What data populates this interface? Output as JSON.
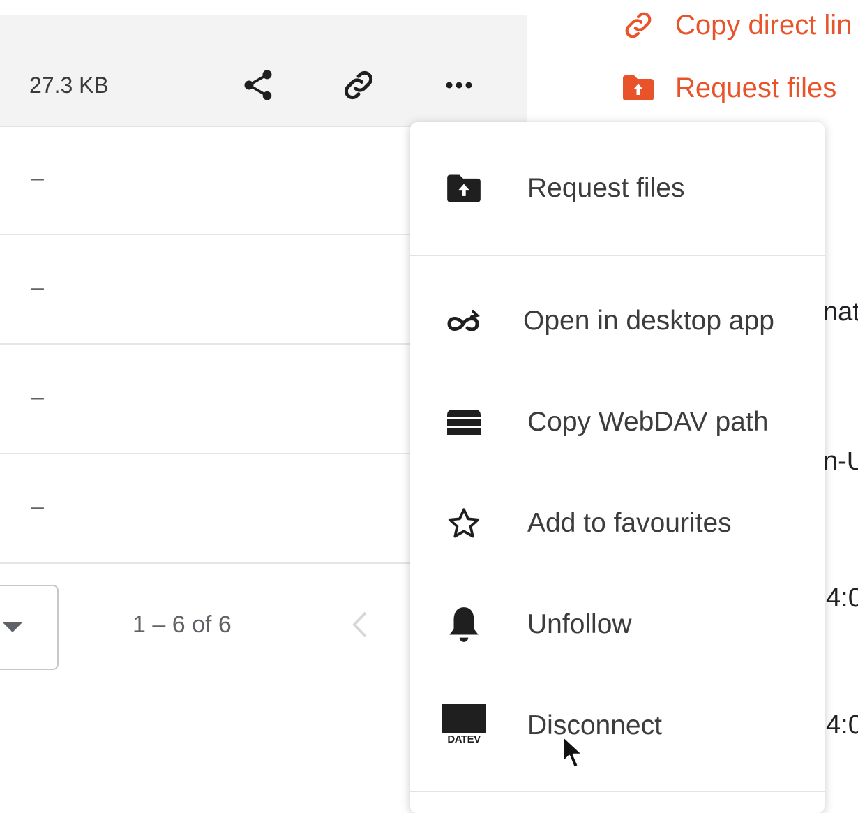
{
  "file_row": {
    "size": "27.3 KB",
    "icons": [
      "share-icon",
      "link-icon",
      "more-icon"
    ]
  },
  "list": {
    "rows": [
      "–",
      "–",
      "–",
      "–"
    ]
  },
  "pagination": {
    "range": "1 – 6 of 6"
  },
  "right_actions": [
    {
      "icon": "link-icon",
      "label": "Copy direct lin"
    },
    {
      "icon": "folder-upload-icon",
      "label": "Request files"
    }
  ],
  "background_fragments": [
    "nat",
    "n-U",
    "4:0",
    "4:0"
  ],
  "context_menu": {
    "items": [
      {
        "icon": "folder-upload-icon",
        "label": "Request files"
      },
      {
        "icon": "desktop-app-icon",
        "label": "Open in desktop app"
      },
      {
        "icon": "webdav-icon",
        "label": "Copy WebDAV path"
      },
      {
        "icon": "star-icon",
        "label": "Add to favourites"
      },
      {
        "icon": "bell-icon",
        "label": "Unfollow"
      },
      {
        "icon": "datev-icon",
        "label": "Disconnect",
        "icon_text": "DATEV"
      }
    ]
  },
  "colors": {
    "accent": "#e8532a",
    "row_background": "#f3f3f4",
    "menu_text": "#3c3c3c"
  }
}
